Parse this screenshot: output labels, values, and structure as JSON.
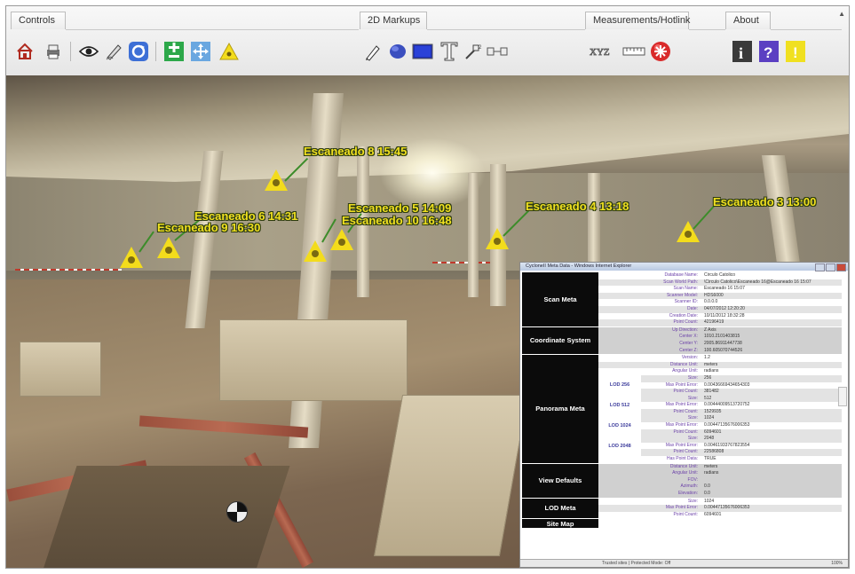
{
  "toolbar": {
    "tabs": [
      {
        "label": "Controls"
      },
      {
        "label": "2D Markups"
      },
      {
        "label": "Measurements/Hotlink"
      },
      {
        "label": "About"
      }
    ],
    "scroll_glyph": "▲",
    "buttons": {
      "home": "home-icon",
      "print": "print-icon",
      "view": "eye-icon",
      "pen": "pen-icon",
      "refresh": "refresh-icon",
      "zoom_plus_minus": "zoom-icon",
      "pan": "pan-icon",
      "marker": "marker-icon",
      "pencil": "pencil-icon",
      "ellipse": "ellipse-icon",
      "rectangle": "rectangle-icon",
      "text": "text-icon",
      "link_tool": "link-tool-icon",
      "xyz": "XYZ",
      "distance": "distance-icon",
      "hotlink": "hotlink-icon",
      "info": "i",
      "help": "?",
      "warn": "!"
    }
  },
  "markers": [
    {
      "label": "Escaneado 8 15:45"
    },
    {
      "label": "Escaneado 6 14:31"
    },
    {
      "label": "Escaneado 9 16:30"
    },
    {
      "label": "Escaneado 5 14:09"
    },
    {
      "label": "Escaneado 10 16:48"
    },
    {
      "label": "Escaneado 4 13:18"
    },
    {
      "label": "Escaneado 3 13:00"
    }
  ],
  "meta_window": {
    "title": "CycloneII Meta Data - Windows Internet Explorer",
    "sections": {
      "scan": {
        "heading": "Scan Meta",
        "rows": [
          {
            "k": "Database Name:",
            "v": "Circulo Catolico"
          },
          {
            "k": "Scan World Path:",
            "v": "\\Circulo Catolico\\Escaneado 16@Escaneado 16 15:07"
          },
          {
            "k": "Scan Name:",
            "v": "Escaneado 16 15:07"
          },
          {
            "k": "Scanner Model:",
            "v": "HDS6000"
          },
          {
            "k": "Scanner ID:",
            "v": "0.0.0.0"
          },
          {
            "k": "Date:",
            "v": "04/07/2012 12:20:20"
          },
          {
            "k": "Creation Date:",
            "v": "10/11/2012 18:32:28"
          },
          {
            "k": "Point Count:",
            "v": "42196419"
          }
        ]
      },
      "coord": {
        "heading": "Coordinate System",
        "rows": [
          {
            "k": "Up Direction:",
            "v": "Z Axis"
          },
          {
            "k": "Center X:",
            "v": "1010.2101403815"
          },
          {
            "k": "Center Y:",
            "v": "2005.86911447738"
          },
          {
            "k": "Center Z:",
            "v": "100.605070744526"
          }
        ]
      },
      "panorama": {
        "heading": "Panorama Meta",
        "rows": [
          {
            "k": "Version:",
            "v": "1.2"
          },
          {
            "k": "Distance Unit:",
            "v": "meters"
          },
          {
            "k": "Angular Unit:",
            "v": "radians"
          }
        ],
        "lods": [
          {
            "lod": "LOD 256",
            "rows": [
              {
                "k": "Size:",
                "v": "256"
              },
              {
                "k": "Max Point Error:",
                "v": "0.00436669434654303"
              },
              {
                "k": "Point Count:",
                "v": "381482"
              }
            ]
          },
          {
            "lod": "LOD 512",
            "rows": [
              {
                "k": "Size:",
                "v": "512"
              },
              {
                "k": "Max Point Error:",
                "v": "0.00444009513720752"
              },
              {
                "k": "Point Count:",
                "v": "1529935"
              }
            ]
          },
          {
            "lod": "LOD 1024",
            "rows": [
              {
                "k": "Size:",
                "v": "1024"
              },
              {
                "k": "Max Point Error:",
                "v": "0.00447135676006353"
              },
              {
                "k": "Point Count:",
                "v": "6094601"
              }
            ]
          },
          {
            "lod": "LOD 2048",
            "rows": [
              {
                "k": "Size:",
                "v": "2048"
              },
              {
                "k": "Max Point Error:",
                "v": "0.00461933767823554"
              },
              {
                "k": "Point Count:",
                "v": "22586808"
              }
            ]
          }
        ],
        "tail_rows": [
          {
            "k": "Has Point Data:",
            "v": "TRUE"
          }
        ]
      },
      "view": {
        "heading": "View Defaults",
        "rows": [
          {
            "k": "Distance Unit:",
            "v": "meters"
          },
          {
            "k": "Angular Unit:",
            "v": "radians"
          },
          {
            "k": "FOV:",
            "v": ""
          },
          {
            "k": "Azimuth:",
            "v": "0.0"
          },
          {
            "k": "Elevation:",
            "v": "0.0"
          }
        ]
      },
      "lod": {
        "heading": "LOD Meta",
        "rows": [
          {
            "k": "Size:",
            "v": "1024"
          },
          {
            "k": "Max Point Error:",
            "v": "0.00447135676006353"
          },
          {
            "k": "Point Count:",
            "v": "6094601"
          }
        ]
      },
      "site": {
        "heading": "Site Map"
      }
    },
    "status_left": "Trusted sites | Protected Mode: Off",
    "status_right": "100%"
  },
  "colors": {
    "marker_fill": "#f3dc1c",
    "label_text": "#f0e020",
    "leader_line": "#3c8c2a",
    "section_header_bg": "#0b0b0b",
    "meta_key": "#6a3fa8"
  }
}
